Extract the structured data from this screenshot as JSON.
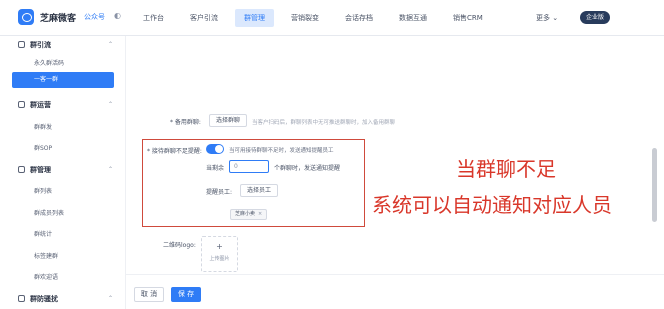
{
  "app": {
    "brand": "芝麻微客",
    "brand_sub": "公众号"
  },
  "nav": {
    "items": [
      "工作台",
      "客户引流",
      "群管理",
      "营销裂变",
      "会话存档",
      "数据互通",
      "销售CRM"
    ],
    "active_index": 2,
    "more": "更多 ⌄",
    "enterprise_badge": "企业版"
  },
  "sidebar": {
    "groups": [
      {
        "label": "群引流",
        "items": [
          "永久群活码",
          "一客一群"
        ]
      },
      {
        "label": "群运营",
        "items": [
          "群群发",
          "群SOP"
        ]
      },
      {
        "label": "群管理",
        "items": [
          "群列表",
          "群成员列表",
          "群统计",
          "标签建群",
          "群欢迎语"
        ]
      },
      {
        "label": "群防骚扰",
        "items": []
      }
    ],
    "active_item": "一客一群"
  },
  "form": {
    "backup_group_label": "* 备用群聊:",
    "backup_group_button": "选择群聊",
    "backup_group_hint": "当客户扫码后，群聊列表中无可推送群聊时，加入备用群聊",
    "remind_label": "* 接待群聊不足提醒:",
    "remind_enabled": true,
    "remind_hint": "当可用接待群聊不足时，发送通知提醒员工",
    "threshold_prefix": "当剩余",
    "threshold_placeholder": "0",
    "threshold_suffix": "个群聊时，发送通知提醒",
    "staff_label": "提醒员工:",
    "staff_button": "选择员工",
    "staff_tag": "芝麻小卖",
    "staff_tag_close": "×",
    "qrcode_logo_label": "二维码logo:",
    "upload_plus": "+",
    "upload_label": "上传图片"
  },
  "annotation": {
    "line1": "当群聊不足",
    "line2": "系统可以自动通知对应人员",
    "color": "#d9372a"
  },
  "footer": {
    "cancel": "取 消",
    "save": "保 存"
  },
  "colors": {
    "primary": "#2f7cf6",
    "highlight_border": "#cf4a3c"
  }
}
